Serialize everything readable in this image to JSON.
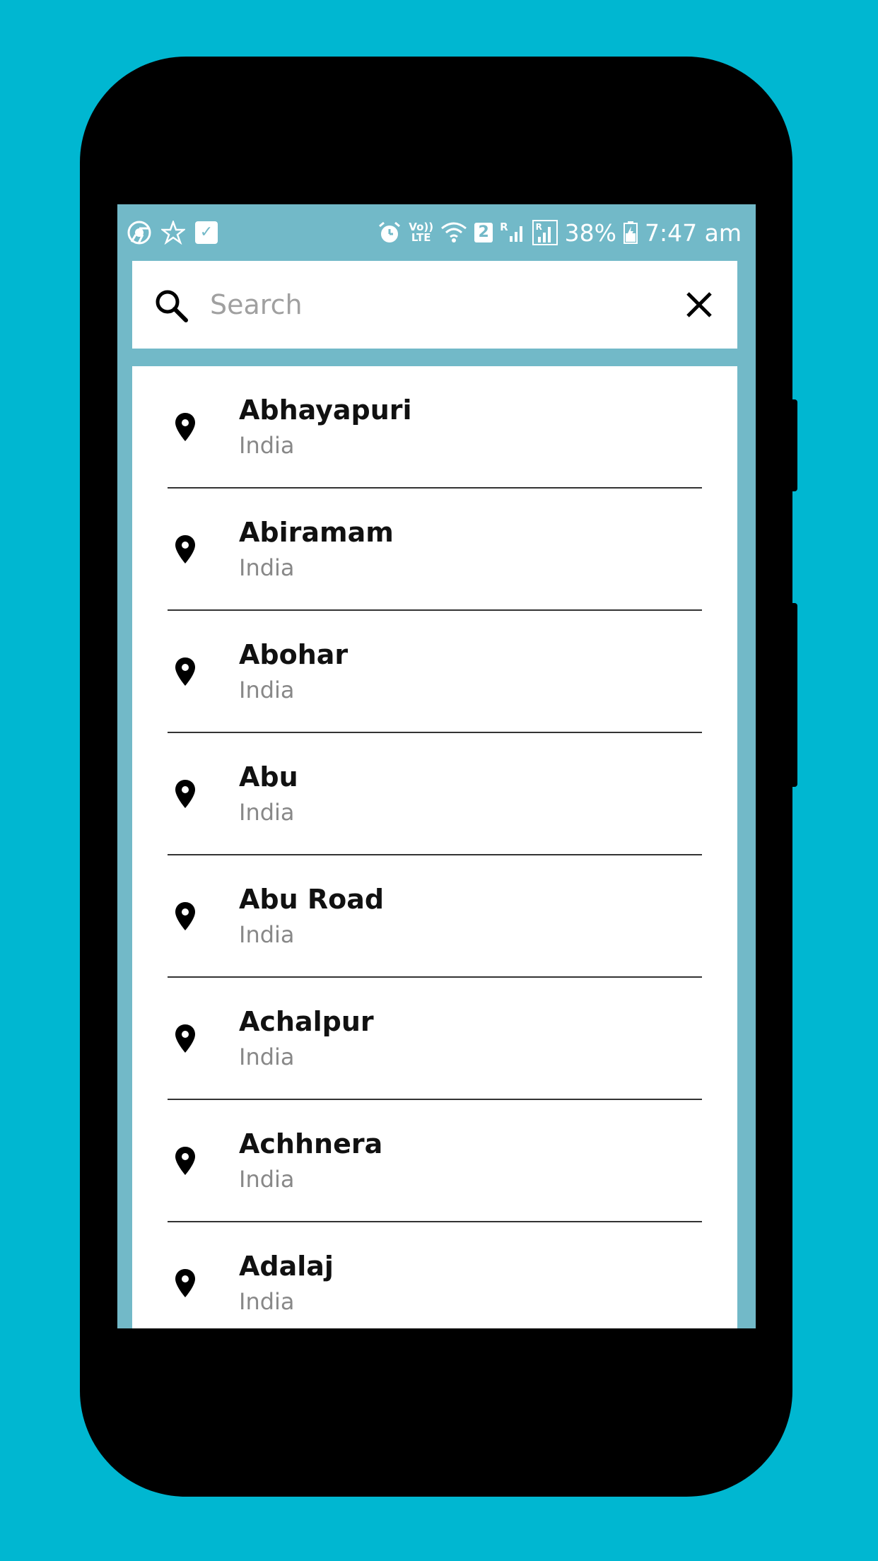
{
  "status_bar": {
    "left_icons": [
      "chrome-icon",
      "star-icon",
      "check-notification-icon"
    ],
    "volte_top": "Vo))",
    "volte_bottom": "LTE",
    "sim_badge": "2",
    "roaming_1": "R",
    "roaming_2": "R",
    "battery": "38%",
    "time": "7:47 am"
  },
  "search": {
    "placeholder": "Search",
    "value": ""
  },
  "results": [
    {
      "city": "Abhayapuri",
      "country": "India"
    },
    {
      "city": "Abiramam",
      "country": "India"
    },
    {
      "city": "Abohar",
      "country": "India"
    },
    {
      "city": "Abu",
      "country": "India"
    },
    {
      "city": "Abu Road",
      "country": "India"
    },
    {
      "city": "Achalpur",
      "country": "India"
    },
    {
      "city": "Achhnera",
      "country": "India"
    },
    {
      "city": "Adalaj",
      "country": "India"
    }
  ],
  "colors": {
    "background": "#00b7d1",
    "app_bar": "#72b9c8",
    "card": "#ffffff",
    "title_text": "#111111",
    "subtitle_text": "#888888"
  }
}
